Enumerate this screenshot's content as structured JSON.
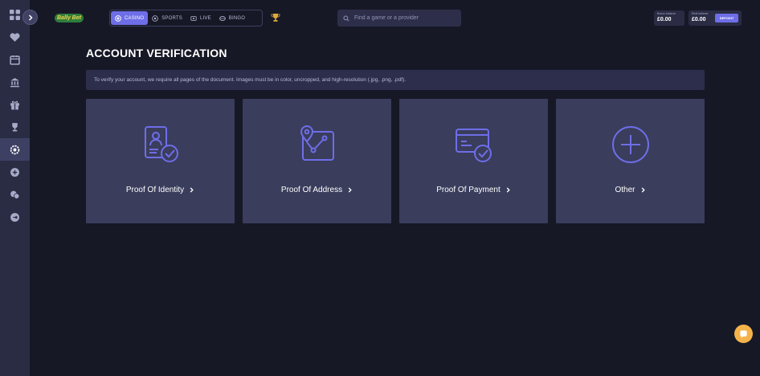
{
  "header": {
    "logo_text": "Bally Bet",
    "nav_tabs": [
      {
        "label": "CASINO",
        "icon": "casino-chip-icon",
        "active": true
      },
      {
        "label": "SPORTS",
        "icon": "football-icon",
        "active": false
      },
      {
        "label": "LIVE",
        "icon": "live-dealer-icon",
        "active": false
      },
      {
        "label": "BINGO",
        "icon": "bingo-ball-icon",
        "active": false
      }
    ],
    "search_placeholder": "Find a game or a provider",
    "bonus_balance": {
      "label": "Bonus balance",
      "value": "£0.00"
    },
    "real_balance": {
      "label": "Real balance",
      "value": "£0.00"
    },
    "deposit_label": "DEPOSIT"
  },
  "sidebar": {
    "items": [
      {
        "icon": "grid-icon",
        "active": false
      },
      {
        "icon": "heart-icon",
        "active": false
      },
      {
        "icon": "calendar-icon",
        "active": false
      },
      {
        "icon": "bank-icon",
        "active": false
      },
      {
        "icon": "gift-icon",
        "active": false
      },
      {
        "icon": "trophy-icon",
        "active": false
      },
      {
        "icon": "settings-icon",
        "active": true
      },
      {
        "icon": "plus-circle-icon",
        "active": false
      },
      {
        "icon": "chat-icon",
        "active": false
      },
      {
        "icon": "logout-icon",
        "active": false
      }
    ]
  },
  "main": {
    "title": "ACCOUNT VERIFICATION",
    "notice": "To verify your account, we require all pages of the document. Images must be in color, uncropped, and high-resolution (.jpg, .png, .pdf).",
    "cards": [
      {
        "label": "Proof Of Identity",
        "icon": "id-card-check-icon"
      },
      {
        "label": "Proof Of Address",
        "icon": "map-route-icon"
      },
      {
        "label": "Proof Of Payment",
        "icon": "credit-card-check-icon"
      },
      {
        "label": "Other",
        "icon": "plus-circle-icon"
      }
    ]
  },
  "colors": {
    "background": "#171826",
    "sidebar": "#2a2c44",
    "card": "#3a3d5c",
    "accent": "#6e6ee8",
    "chat": "#f4b34a"
  }
}
